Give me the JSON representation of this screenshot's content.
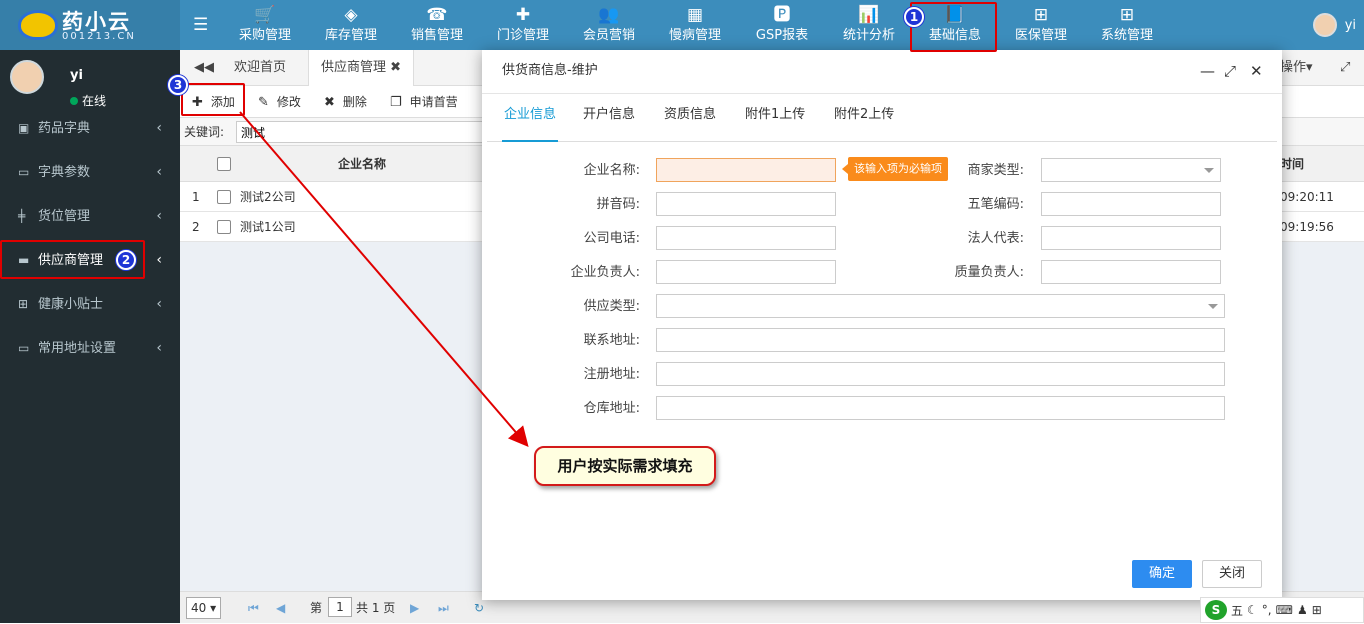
{
  "app": {
    "logo_text": "药小云",
    "logo_site": "001213.CN",
    "user": "yi"
  },
  "nav": [
    {
      "icon": "cart-icon",
      "glyph": "🛒",
      "label": "采购管理"
    },
    {
      "icon": "cube-icon",
      "glyph": "◈",
      "label": "库存管理"
    },
    {
      "icon": "phone-icon",
      "glyph": "☎",
      "label": "销售管理"
    },
    {
      "icon": "medkit-icon",
      "glyph": "✚",
      "label": "门诊管理"
    },
    {
      "icon": "users-icon",
      "glyph": "👥",
      "label": "会员营销"
    },
    {
      "icon": "hospital-icon",
      "glyph": "▦",
      "label": "慢病管理"
    },
    {
      "icon": "file-p-icon",
      "glyph": "🅿",
      "label": "GSP报表"
    },
    {
      "icon": "bar-chart-icon",
      "glyph": "📊",
      "label": "统计分析"
    },
    {
      "icon": "book-icon",
      "glyph": "📘",
      "label": "基础信息"
    },
    {
      "icon": "windows-icon",
      "glyph": "⊞",
      "label": "医保管理"
    },
    {
      "icon": "windows-icon",
      "glyph": "⊞",
      "label": "系统管理"
    }
  ],
  "sidebar": {
    "user_name": "yi",
    "status": "在线",
    "items": [
      {
        "icon": "book-icon",
        "glyph": "▣",
        "label": "药品字典"
      },
      {
        "icon": "monitor-icon",
        "glyph": "▭",
        "label": "字典参数"
      },
      {
        "icon": "shelf-icon",
        "glyph": "╪",
        "label": "货位管理"
      },
      {
        "icon": "truck-icon",
        "glyph": "▬",
        "label": "供应商管理"
      },
      {
        "icon": "medkit-icon",
        "glyph": "⊞",
        "label": "健康小贴士"
      },
      {
        "icon": "monitor-icon",
        "glyph": "▭",
        "label": "常用地址设置"
      }
    ]
  },
  "tabs": {
    "home": "欢迎首页",
    "supplier": "供应商管理",
    "ops": "操作"
  },
  "toolbar": {
    "add": "添加",
    "edit": "修改",
    "delete": "删除",
    "apply": "申请首营"
  },
  "search": {
    "label": "关键词:",
    "value": "测试"
  },
  "grid": {
    "col_name": "企业名称",
    "col_time": "时间",
    "rows": [
      {
        "num": "1",
        "name": "测试2公司",
        "time": "09:20:11"
      },
      {
        "num": "2",
        "name": "测试1公司",
        "time": "09:19:56"
      }
    ]
  },
  "pager": {
    "page_size": "40",
    "page_label": "第",
    "page": "1",
    "total": "共 1 页"
  },
  "modal": {
    "title": "供货商信息-维护",
    "tabs": [
      "企业信息",
      "开户信息",
      "资质信息",
      "附件1上传",
      "附件2上传"
    ],
    "fields": {
      "company_name": "企业名称:",
      "merchant_type": "商家类型:",
      "pinyin": "拼音码:",
      "wubi": "五笔编码:",
      "phone": "公司电话:",
      "legal_rep": "法人代表:",
      "manager": "企业负责人:",
      "quality_manager": "质量负责人:",
      "supply_type": "供应类型:",
      "contact_addr": "联系地址:",
      "reg_addr": "注册地址:",
      "warehouse_addr": "仓库地址:"
    },
    "required_tip": "该输入项为必输项",
    "ok": "确定",
    "close": "关闭"
  },
  "annotations": {
    "step1": "1",
    "step2": "2",
    "step3": "3",
    "callout": "用户按实际需求填充"
  },
  "ime": {
    "mode": "五"
  }
}
